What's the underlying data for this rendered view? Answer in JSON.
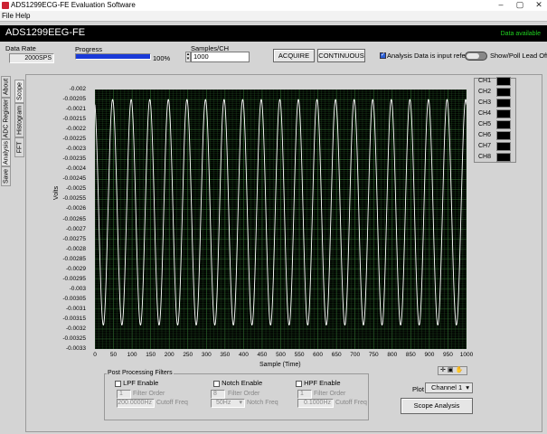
{
  "window": {
    "title": "ADS1299ECG-FE Evaluation Software"
  },
  "menu": {
    "items": [
      "File",
      "Help"
    ]
  },
  "app": {
    "name": "ADS1299EEG-FE",
    "status": "Data available"
  },
  "controls": {
    "data_rate_label": "Data Rate",
    "data_rate_value": "2000SPS",
    "progress_label": "Progress",
    "progress_value": "100%",
    "progress_fraction": 1.0,
    "samples_label": "Samples/CH",
    "samples_value": "1000",
    "acquire_label": "ACQUIRE",
    "continuous_label": "CONTINUOUS",
    "input_referred_label": "Analysis Data is input referred",
    "input_referred_checked": true,
    "lead_off_label": "Show/Poll Lead Off Sta"
  },
  "left_tabs": [
    "About",
    "ADC Register",
    "Analysis",
    "Save"
  ],
  "sub_tabs": [
    "Scope",
    "Histogram",
    "FFT"
  ],
  "channels": [
    "CH1",
    "CH2",
    "CH3",
    "CH4",
    "CH5",
    "CH6",
    "CH7",
    "CH8"
  ],
  "filters": {
    "title": "Post Processing Filters",
    "lpf": {
      "label": "LPF Enable",
      "order_value": "1",
      "order_label": "Filter Order",
      "freq_value": "200.0000Hz",
      "freq_label": "Cutoff Freq"
    },
    "notch": {
      "label": "Notch Enable",
      "order_value": "8",
      "order_label": "Filter Order",
      "freq_value": "50Hz",
      "freq_label": "Notch Freq"
    },
    "hpf": {
      "label": "HPF Enable",
      "order_value": "1",
      "order_label": "Filter Order",
      "freq_value": "0.1000Hz",
      "freq_label": "Cutoff Freq"
    }
  },
  "plot_select": {
    "label": "Plot",
    "value": "Channel 1"
  },
  "scope_analysis_label": "Scope Analysis",
  "chart_data": {
    "type": "line",
    "xlabel": "Sample (Time)",
    "ylabel": "Volts",
    "xlim": [
      0,
      1000
    ],
    "ylim": [
      -0.0033,
      -0.002
    ],
    "x_ticks": [
      0,
      50,
      100,
      150,
      200,
      250,
      300,
      350,
      400,
      450,
      500,
      550,
      600,
      650,
      700,
      750,
      800,
      850,
      900,
      950,
      1000
    ],
    "y_ticks": [
      "-0.002",
      "-0.00205",
      "-0.0021",
      "-0.00215",
      "-0.0022",
      "-0.00225",
      "-0.0023",
      "-0.00235",
      "-0.0024",
      "-0.00245",
      "-0.0025",
      "-0.00255",
      "-0.0026",
      "-0.00265",
      "-0.0027",
      "-0.00275",
      "-0.0028",
      "-0.00285",
      "-0.0029",
      "-0.00295",
      "-0.003",
      "-0.00305",
      "-0.0031",
      "-0.00315",
      "-0.0032",
      "-0.00325",
      "-0.0033"
    ],
    "grid": true,
    "series": [
      {
        "color": "#ffffff",
        "waveform": "sine",
        "cycles": 20,
        "max": -0.00205,
        "min": -0.00318
      }
    ],
    "plot_bg": "#000000",
    "grid_color": "#2f6b2f"
  }
}
